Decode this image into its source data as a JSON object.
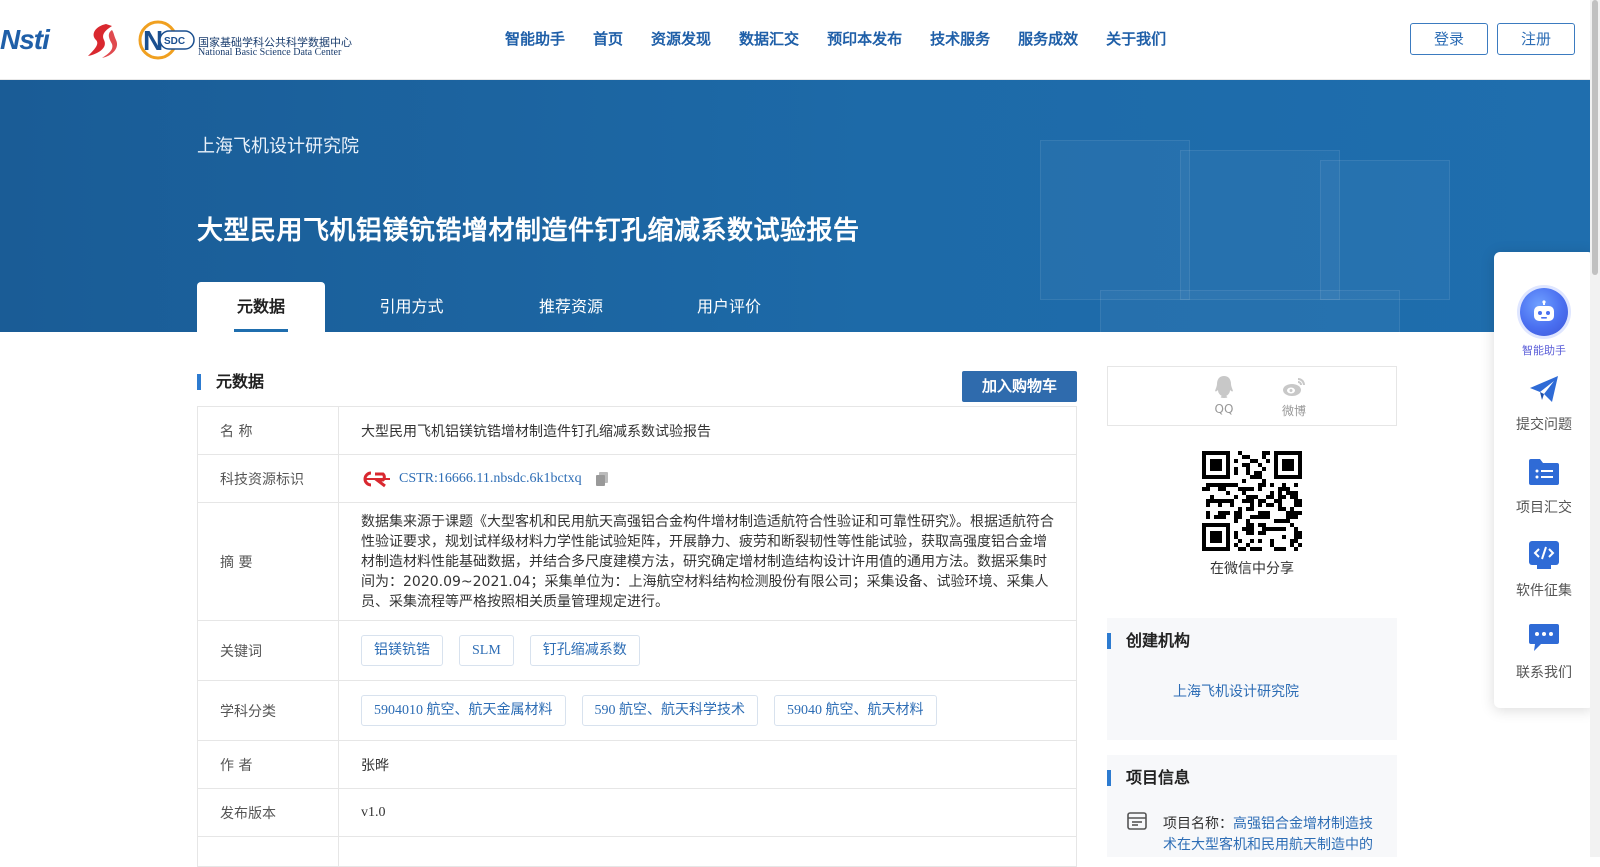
{
  "header": {
    "logos": {
      "nsti": "Nsti",
      "nsdc_cn": "国家基础学科公共科学数据中心",
      "nsdc_en": "National Basic Science Data Center",
      "nsdc_mark": "SDC"
    },
    "nav": [
      "智能助手",
      "首页",
      "资源发现",
      "数据汇交",
      "预印本发布",
      "技术服务",
      "服务成效",
      "关于我们"
    ],
    "login": "登录",
    "register": "注册"
  },
  "banner": {
    "org": "上海飞机设计研究院",
    "title": "大型民用飞机铝镁钪锆增材制造件钉孔缩减系数试验报告",
    "tabs": [
      "元数据",
      "引用方式",
      "推荐资源",
      "用户评价"
    ],
    "active_tab": 0
  },
  "metadata": {
    "section_title": "元数据",
    "cart_button": "加入购物车",
    "name_label": "名  称",
    "name_value": "大型民用飞机铝镁钪锆增材制造件钉孔缩减系数试验报告",
    "id_label": "科技资源标识",
    "id_value": "CSTR:16666.11.nbsdc.6k1bctxq",
    "abstract_label": "摘  要",
    "abstract_value": "数据集来源于课题《大型客机和民用航天高强铝合金构件增材制造适航符合性验证和可靠性研究》。根据适航符合性验证要求，规划试样级材料力学性能试验矩阵，开展静力、疲劳和断裂韧性等性能试验，获取高强度铝合金增材制造材料性能基础数据，并结合多尺度建模方法，研究确定增材制造结构设计许用值的通用方法。数据采集时间为：2020.09~2021.04；采集单位为：上海航空材料结构检测股份有限公司；采集设备、试验环境、采集人员、采集流程等严格按照相关质量管理规定进行。",
    "keywords_label": "关键词",
    "keywords": [
      "铝镁钪锆",
      "SLM",
      "钉孔缩减系数"
    ],
    "subject_label": "学科分类",
    "subjects": [
      "5904010 航空、航天金属材料",
      "590 航空、航天科学技术",
      "59040 航空、航天材料"
    ],
    "author_label": "作  者",
    "author_value": "张晔",
    "version_label": "发布版本",
    "version_value": "v1.0"
  },
  "share": {
    "qq": "QQ",
    "weibo": "微博",
    "wechat_caption": "在微信中分享"
  },
  "creator": {
    "title": "创建机构",
    "org": "上海飞机设计研究院"
  },
  "project": {
    "title": "项目信息",
    "name_label": "项目名称：",
    "name_line1": "高强铝合金增材制造技",
    "name_line2": "术在大型客机和民用航天制造中的"
  },
  "float_panel": {
    "items": [
      "智能助手",
      "提交问题",
      "项目汇交",
      "软件征集",
      "联系我们"
    ]
  },
  "colors": {
    "primary": "#1f6eae",
    "accent": "#2d7bd0",
    "button": "#2f6bad",
    "ai": "#4a6ff0"
  }
}
